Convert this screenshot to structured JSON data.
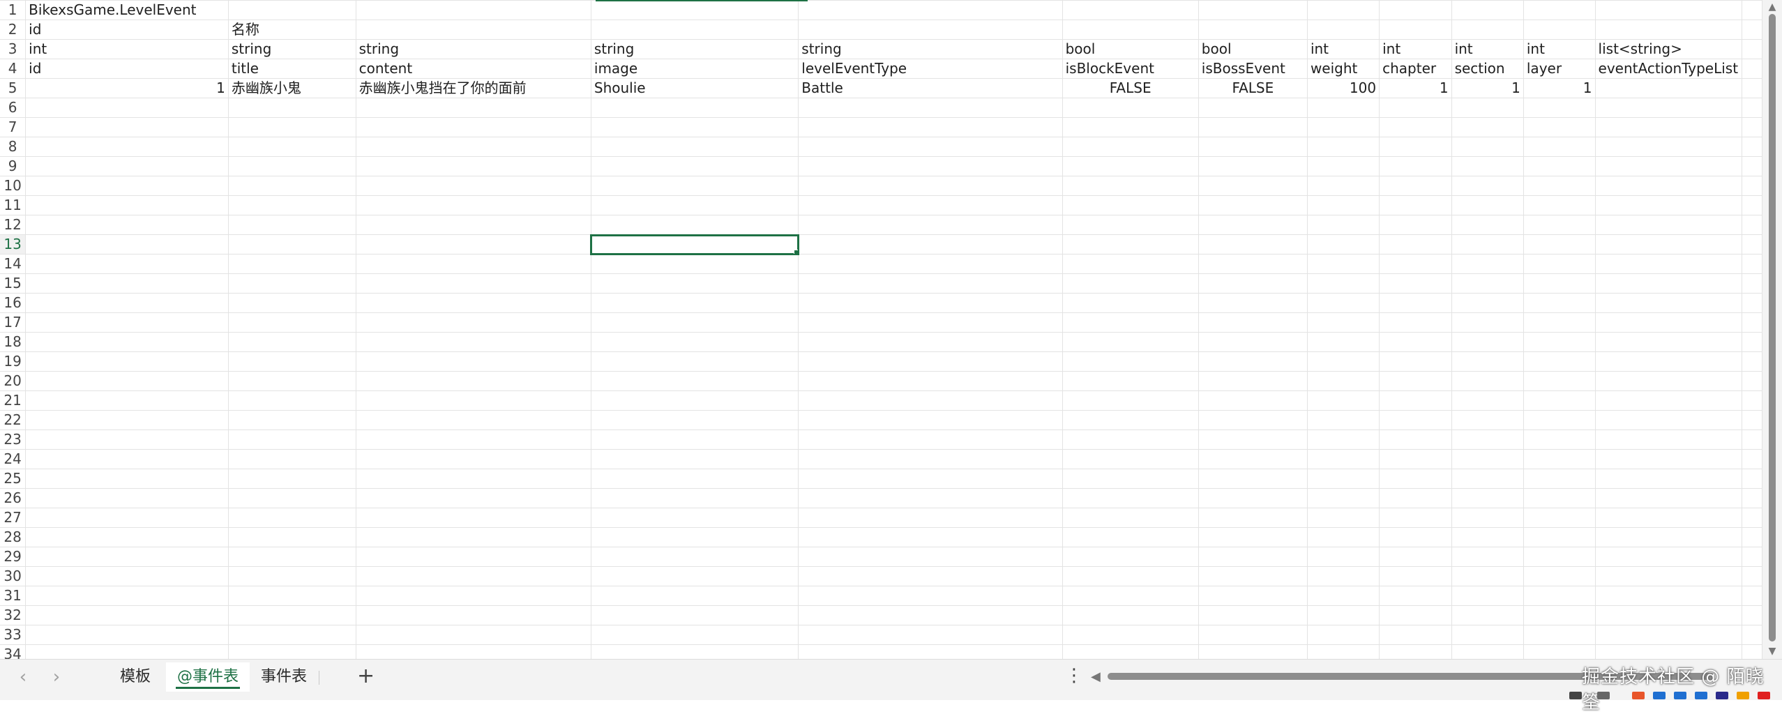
{
  "sheet": {
    "row_numbers": [
      "1",
      "2",
      "3",
      "4",
      "5",
      "6",
      "7",
      "8",
      "9",
      "10",
      "11",
      "12",
      "13",
      "14",
      "15",
      "16",
      "17",
      "18",
      "19",
      "20",
      "21",
      "22",
      "23",
      "24",
      "25",
      "26",
      "27",
      "28",
      "29",
      "30",
      "31",
      "32",
      "33",
      "34"
    ],
    "active_row": "13",
    "rows": [
      [
        "BikexsGame.LevelEvent",
        "",
        "",
        "",
        "",
        "",
        "",
        "",
        "",
        "",
        "",
        "",
        ""
      ],
      [
        "id",
        "名称",
        "",
        "",
        "",
        "",
        "",
        "",
        "",
        "",
        "",
        "",
        ""
      ],
      [
        "int",
        "string",
        "string",
        "string",
        "string",
        "bool",
        "bool",
        "int",
        "int",
        "int",
        "int",
        "list<string>",
        ""
      ],
      [
        "id",
        "title",
        "content",
        "image",
        "levelEventType",
        "isBlockEvent",
        "isBossEvent",
        "weight",
        "chapter",
        "section",
        "layer",
        "eventActionTypeList",
        ""
      ],
      [
        "1",
        "赤幽族小鬼",
        "赤幽族小鬼挡在了你的面前",
        "Shoulie",
        "Battle",
        "FALSE",
        "FALSE",
        "100",
        "1",
        "1",
        "1",
        "",
        ""
      ]
    ]
  },
  "tabs": [
    {
      "label": "模板"
    },
    {
      "label": "@事件表"
    },
    {
      "label": "事件表"
    }
  ],
  "active_tab": "@事件表",
  "add_sheet_label": "+",
  "more_label": "⋮",
  "nav": {
    "prev": "‹",
    "next": "›"
  },
  "watermark": "掘金技术社区 @ 陌晓筌",
  "colors": {
    "accent": "#1e7145"
  },
  "icons": [
    "chevron-left-icon",
    "chevron-right-icon",
    "plus-icon",
    "more-vertical-icon",
    "triangle-left-icon"
  ]
}
